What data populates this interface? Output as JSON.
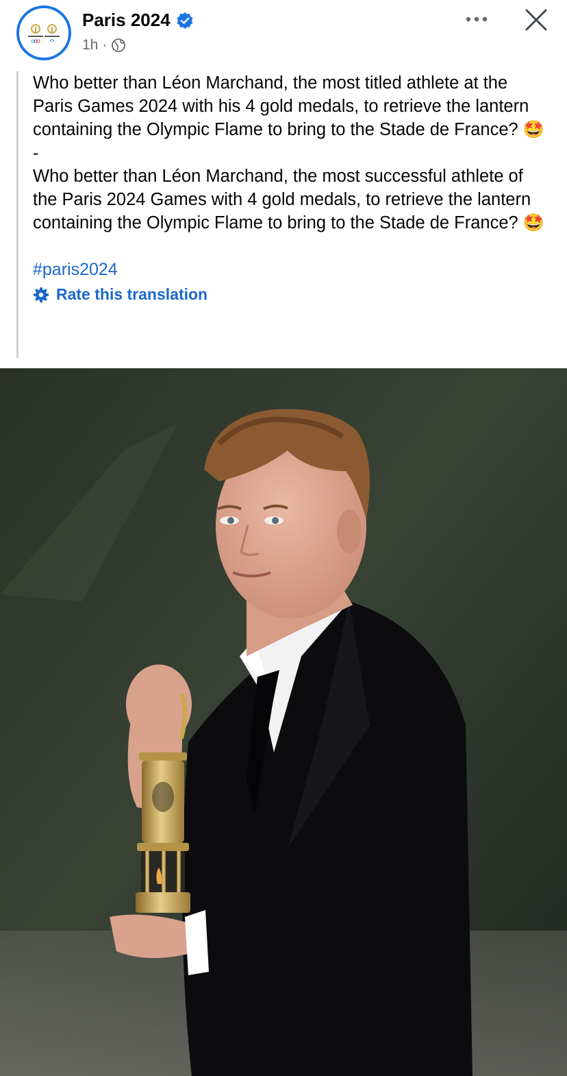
{
  "post": {
    "page_name": "Paris 2024",
    "timestamp": "1h",
    "separator": "·",
    "icons": {
      "avatar": "paris-2024-logo",
      "verified": "verified-badge-icon",
      "audience": "globe-icon",
      "more": "more-options-icon",
      "close": "close-icon"
    },
    "paragraph_1": "Who better than Léon Marchand, the most titled athlete at the Paris Games 2024 with his 4 gold medals, to retrieve the lantern containing the Olympic Flame to bring to the Stade de France?",
    "emoji_1": "🤩",
    "divider": "-",
    "paragraph_2": "Who better than Léon Marchand, the most successful athlete of the Paris 2024 Games with 4 gold medals, to retrieve the lantern containing the Olympic Flame to bring to the Stade de France?",
    "emoji_2": "🤩",
    "hashtag": "#paris2024",
    "rate_translation": "Rate this translation"
  },
  "colors": {
    "link": "#1d68c9",
    "verified": "#1b74e4",
    "secondary_text": "#65676b"
  }
}
